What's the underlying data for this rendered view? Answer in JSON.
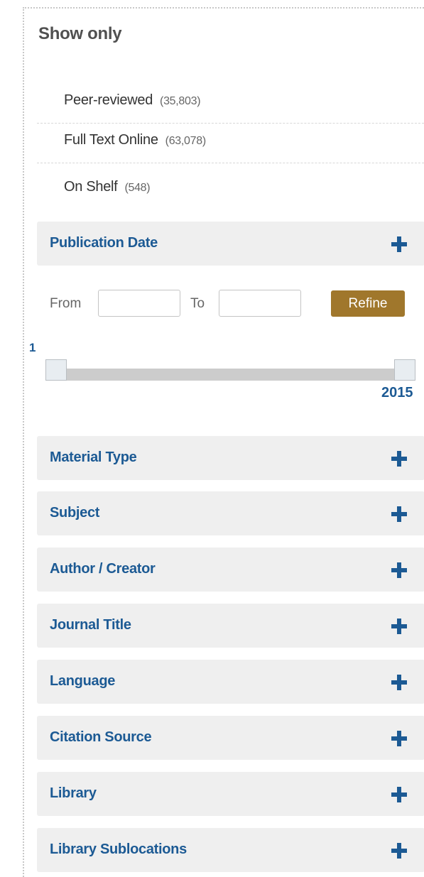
{
  "show_only": {
    "title": "Show only",
    "items": [
      {
        "label": "Peer-reviewed",
        "count": "(35,803)"
      },
      {
        "label": "Full Text Online",
        "count": "(63,078)"
      },
      {
        "label": "On Shelf",
        "count": "(548)"
      }
    ]
  },
  "publication_date": {
    "title": "Publication Date",
    "from_label": "From",
    "to_label": "To",
    "from_value": "",
    "to_value": "",
    "refine_label": "Refine",
    "slider_min": "1",
    "slider_max": "2015"
  },
  "facets": [
    {
      "label": "Material Type"
    },
    {
      "label": "Subject"
    },
    {
      "label": "Author / Creator"
    },
    {
      "label": "Journal Title"
    },
    {
      "label": "Language"
    },
    {
      "label": "Citation Source"
    },
    {
      "label": "Library"
    },
    {
      "label": "Library Sublocations"
    }
  ],
  "icons": {
    "expand": "plus-icon"
  },
  "colors": {
    "facet_text": "#1c5a94",
    "facet_bg": "#efefef",
    "refine_button": "#a0772c"
  }
}
